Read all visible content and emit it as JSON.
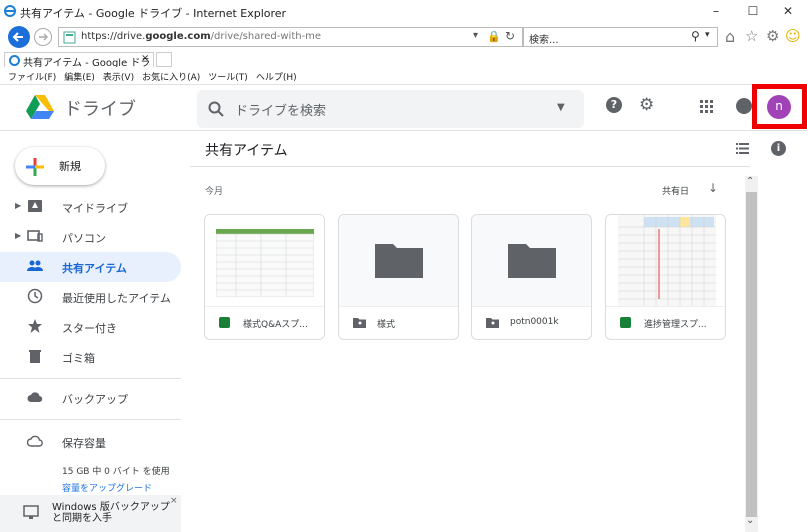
{
  "browser": {
    "window_title": "共有アイテム - Google ドライブ - Internet Explorer",
    "url_prefix": "https://drive.",
    "url_domain": "google.com",
    "url_path": "/drive/shared-with-me",
    "search_placeholder": "検索...",
    "tab_label": "共有アイテム - Google ドライブ",
    "tab_close": "×",
    "menu": [
      "ファイル(F)",
      "編集(E)",
      "表示(V)",
      "お気に入り(A)",
      "ツール(T)",
      "ヘルプ(H)"
    ]
  },
  "header": {
    "brand": "ドライブ",
    "search_placeholder": "ドライブを検索",
    "avatar_letter": "n",
    "avatar_color": "#a142b6"
  },
  "sidebar": {
    "new_label": "新規",
    "items": [
      {
        "label": "マイドライブ",
        "icon": "drive-icon"
      },
      {
        "label": "パソコン",
        "icon": "computer-icon"
      },
      {
        "label": "共有アイテム",
        "icon": "people-icon"
      },
      {
        "label": "最近使用したアイテム",
        "icon": "clock-icon"
      },
      {
        "label": "スター付き",
        "icon": "star-icon"
      },
      {
        "label": "ゴミ箱",
        "icon": "trash-icon"
      },
      {
        "label": "バックアップ",
        "icon": "cloud-icon"
      },
      {
        "label": "保存容量",
        "icon": "cloud-outline-icon"
      }
    ],
    "storage_usage": "15 GB 中 0 バイト を使用",
    "upgrade_link": "容量をアップグレード",
    "backup_promo_line1": "Windows 版バックアップ",
    "backup_promo_line2": "と同期を入手",
    "promo_close": "×"
  },
  "main": {
    "title": "共有アイテム",
    "section_label": "今月",
    "sort_label": "共有日",
    "files": [
      {
        "name": "様式Q&Aスプ...",
        "type": "spreadsheet",
        "icon_color": "#188038"
      },
      {
        "name": "様式",
        "type": "folder",
        "icon_color": "#5f6368"
      },
      {
        "name": "potn0001k",
        "type": "folder",
        "icon_color": "#5f6368"
      },
      {
        "name": "進捗管理スプ...",
        "type": "spreadsheet",
        "icon_color": "#188038"
      }
    ]
  },
  "colors": {
    "accent": "#1a73e8",
    "active_bg": "#e8f0fe",
    "highlight_box": "#ee0000"
  }
}
